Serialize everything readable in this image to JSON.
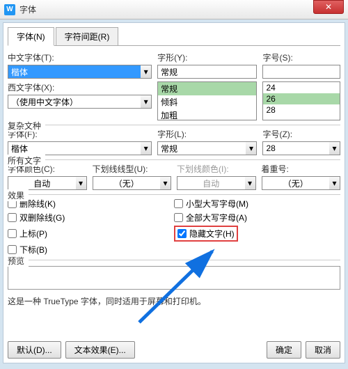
{
  "window": {
    "title": "字体",
    "icon": "W"
  },
  "tabs": {
    "font": "字体(N)",
    "spacing": "字符间距(R)"
  },
  "top": {
    "cjkFont": {
      "label": "中文字体(T):",
      "value": "楷体"
    },
    "style": {
      "label": "字形(Y):",
      "value": "常规",
      "options": [
        "常规",
        "倾斜",
        "加粗"
      ]
    },
    "size": {
      "label": "字号(S):",
      "value": "",
      "options": [
        "24",
        "26",
        "28"
      ]
    },
    "westFont": {
      "label": "西文字体(X):",
      "value": "（使用中文字体）"
    }
  },
  "complex": {
    "legend": "复杂文种",
    "font": {
      "label": "字体(F):",
      "value": "楷体"
    },
    "style": {
      "label": "字形(L):",
      "value": "常规"
    },
    "size": {
      "label": "字号(Z):",
      "value": "28"
    }
  },
  "all": {
    "legend": "所有文字",
    "color": {
      "label": "字体颜色(C):",
      "value": "自动"
    },
    "underline": {
      "label": "下划线线型(U):",
      "value": "（无）"
    },
    "ulcolor": {
      "label": "下划线颜色(I):",
      "value": "自动"
    },
    "emphasis": {
      "label": "着重号:",
      "value": "（无）"
    }
  },
  "effects": {
    "legend": "效果",
    "strike": "删除线(K)",
    "dstrike": "双删除线(G)",
    "superscript": "上标(P)",
    "subscript": "下标(B)",
    "smallcaps": "小型大写字母(M)",
    "allcaps": "全部大写字母(A)",
    "hidden": "隐藏文字(H)"
  },
  "preview": {
    "legend": "预览"
  },
  "note": "这是一种 TrueType 字体，同时适用于屏幕和打印机。",
  "buttons": {
    "default": "默认(D)...",
    "textfx": "文本效果(E)...",
    "ok": "确定",
    "cancel": "取消"
  }
}
